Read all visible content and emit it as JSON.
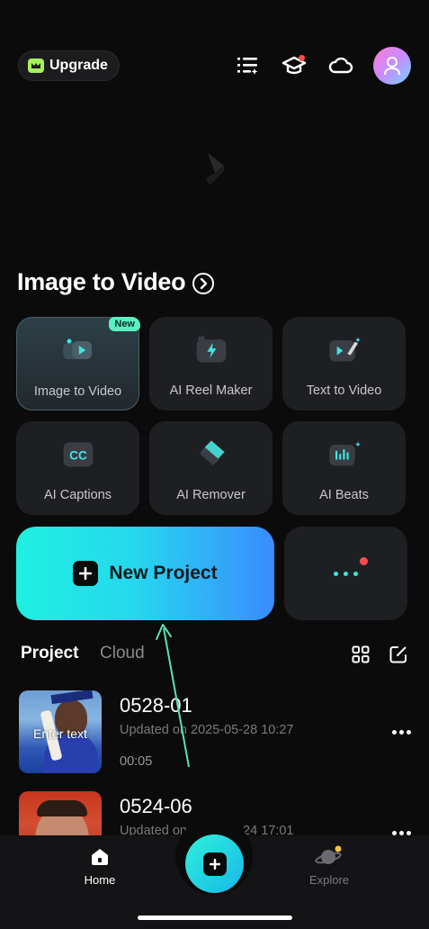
{
  "header": {
    "upgrade_label": "Upgrade",
    "icons": [
      "task-list-icon",
      "graduation-cap-icon",
      "cloud-icon",
      "profile-avatar"
    ]
  },
  "section": {
    "title": "Image to Video"
  },
  "tools": [
    {
      "label": "Image to Video",
      "icon": "image-to-video-icon",
      "badge": "New"
    },
    {
      "label": "AI Reel Maker",
      "icon": "reel-maker-icon"
    },
    {
      "label": "Text to Video",
      "icon": "text-to-video-icon"
    },
    {
      "label": "AI Captions",
      "icon": "captions-icon"
    },
    {
      "label": "AI Remover",
      "icon": "eraser-icon"
    },
    {
      "label": "AI Beats",
      "icon": "beats-icon"
    }
  ],
  "actions": {
    "new_project_label": "New Project"
  },
  "tabs": {
    "project": "Project",
    "cloud": "Cloud"
  },
  "projects": [
    {
      "title": "0528-01",
      "updated": "Updated on 2025-05-28 10:27",
      "duration": "00:05",
      "thumb_text": "Enter text"
    },
    {
      "title": "0524-06",
      "updated": "Updated on 2025-05-24 17:01"
    }
  ],
  "nav": {
    "home_label": "Home",
    "explore_label": "Explore"
  },
  "colors": {
    "accent": "#25d8ee",
    "badge": "#5bf0c2",
    "notification": "#ff4d4f",
    "background": "#0b0b0c"
  }
}
